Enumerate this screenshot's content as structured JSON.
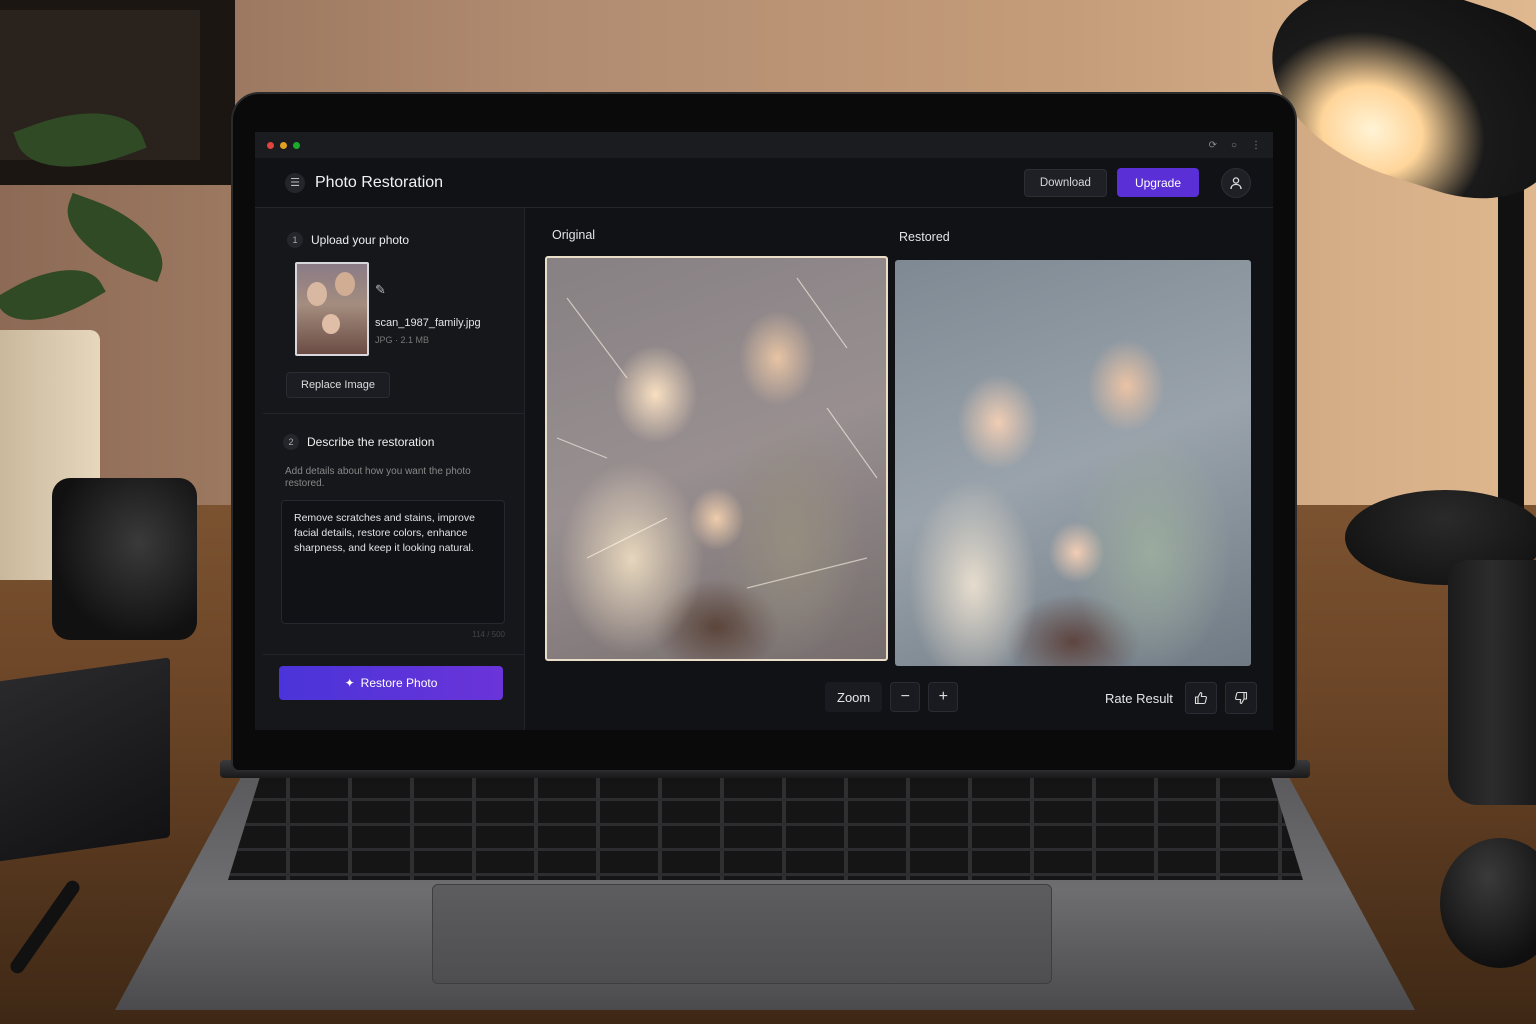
{
  "window": {
    "title": "Photo Restoration"
  },
  "header": {
    "download_label": "Download",
    "upgrade_label": "Upgrade"
  },
  "sidebar": {
    "step1": {
      "number": "1",
      "title": "Upload your photo"
    },
    "file": {
      "name": "scan_1987_family.jpg",
      "meta": "JPG · 2.1 MB"
    },
    "replace_label": "Replace Image",
    "step2": {
      "number": "2",
      "title": "Describe the restoration"
    },
    "hint": "Add details about how you want the photo restored.",
    "prompt_text": "Remove scratches and stains, improve facial details, restore colors, enhance sharpness, and keep it looking natural.",
    "char_count": "114 / 500",
    "restore_label": "Restore Photo"
  },
  "main": {
    "original_label": "Original",
    "restored_label": "Restored",
    "zoom_label": "Zoom",
    "zoom_out": "−",
    "zoom_in": "+",
    "rate_label": "Rate Result"
  },
  "colors": {
    "accent": "#5b2fd6",
    "panel": "#16171b",
    "background": "#111215"
  },
  "icons": [
    "menu-icon",
    "user-icon",
    "sparkle-icon",
    "thumbs-up-icon",
    "thumbs-down-icon"
  ]
}
